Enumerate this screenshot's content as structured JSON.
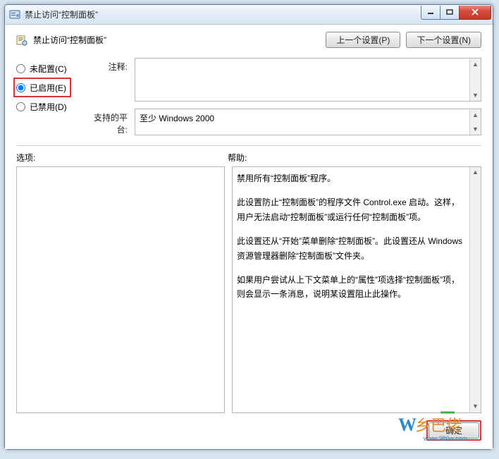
{
  "window": {
    "title": "禁止访问“控制面板”"
  },
  "header": {
    "policy_name": "禁止访问“控制面板”",
    "prev_label": "上一个设置(P)",
    "next_label": "下一个设置(N)"
  },
  "radios": {
    "not_configured": "未配置(C)",
    "enabled": "已启用(E)",
    "disabled": "已禁用(D)",
    "selected": "enabled"
  },
  "meta": {
    "comment_label": "注释:",
    "comment_value": "",
    "platform_label": "支持的平台:",
    "platform_value": "至少 Windows 2000"
  },
  "labels": {
    "options": "选项:",
    "help": "帮助:"
  },
  "help_text": {
    "p1": "禁用所有“控制面板”程序。",
    "p2": "此设置防止“控制面板”的程序文件 Control.exe 启动。这样，用户无法启动“控制面板”或运行任何“控制面板”项。",
    "p3": "此设置还从“开始”菜单删除“控制面板”。此设置还从 Windows 资源管理器删除“控制面板”文件夹。",
    "p4": "如果用户尝试从上下文菜单上的“属性”项选择“控制面板”项，则会显示一条消息，说明某设置阻止此操作。"
  },
  "footer": {
    "ok": "确定"
  }
}
